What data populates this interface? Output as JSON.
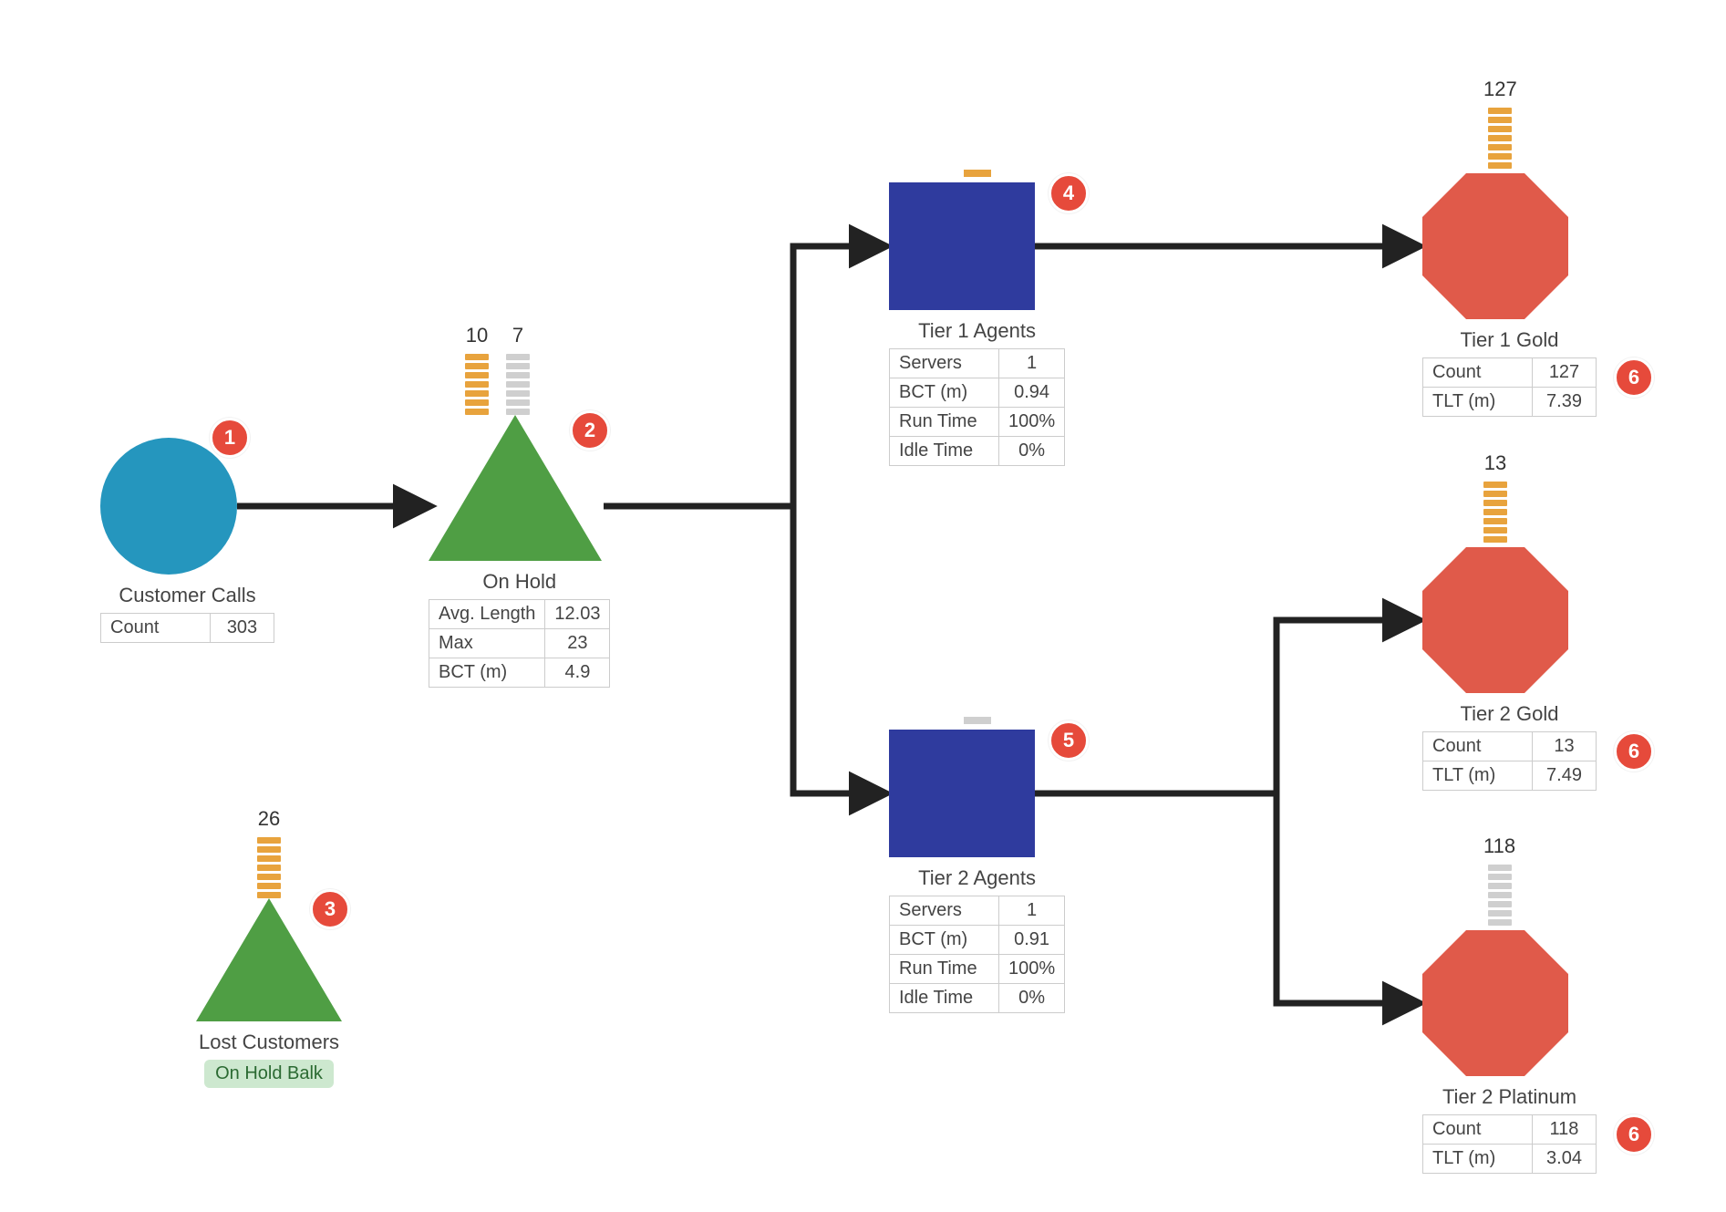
{
  "callouts": {
    "b1": "1",
    "b2": "2",
    "b3": "3",
    "b4": "4",
    "b5": "5",
    "b6": "6"
  },
  "customer_calls": {
    "title": "Customer Calls",
    "rows": {
      "count_key": "Count",
      "count_val": "303"
    }
  },
  "on_hold": {
    "title": "On Hold",
    "stack_gold": "10",
    "stack_grey": "7",
    "rows": {
      "avg_key": "Avg. Length",
      "avg_val": "12.03",
      "max_key": "Max",
      "max_val": "23",
      "bct_key": "BCT (m)",
      "bct_val": "4.9"
    }
  },
  "lost_customers": {
    "title": "Lost Customers",
    "stack_gold": "26",
    "pill": "On Hold Balk"
  },
  "tier1_agents": {
    "title": "Tier 1 Agents",
    "rows": {
      "srv_key": "Servers",
      "srv_val": "1",
      "bct_key": "BCT (m)",
      "bct_val": "0.94",
      "run_key": "Run Time",
      "run_val": "100%",
      "idle_key": "Idle Time",
      "idle_val": "0%"
    }
  },
  "tier2_agents": {
    "title": "Tier 2 Agents",
    "rows": {
      "srv_key": "Servers",
      "srv_val": "1",
      "bct_key": "BCT (m)",
      "bct_val": "0.91",
      "run_key": "Run Time",
      "run_val": "100%",
      "idle_key": "Idle Time",
      "idle_val": "0%"
    }
  },
  "tier1_gold": {
    "title": "Tier 1 Gold",
    "stack": "127",
    "rows": {
      "cnt_key": "Count",
      "cnt_val": "127",
      "tlt_key": "TLT (m)",
      "tlt_val": "7.39"
    }
  },
  "tier2_gold": {
    "title": "Tier 2 Gold",
    "stack": "13",
    "rows": {
      "cnt_key": "Count",
      "cnt_val": "13",
      "tlt_key": "TLT (m)",
      "tlt_val": "7.49"
    }
  },
  "tier2_platinum": {
    "title": "Tier 2 Platinum",
    "stack": "118",
    "rows": {
      "cnt_key": "Count",
      "cnt_val": "118",
      "tlt_key": "TLT (m)",
      "tlt_val": "3.04"
    }
  }
}
